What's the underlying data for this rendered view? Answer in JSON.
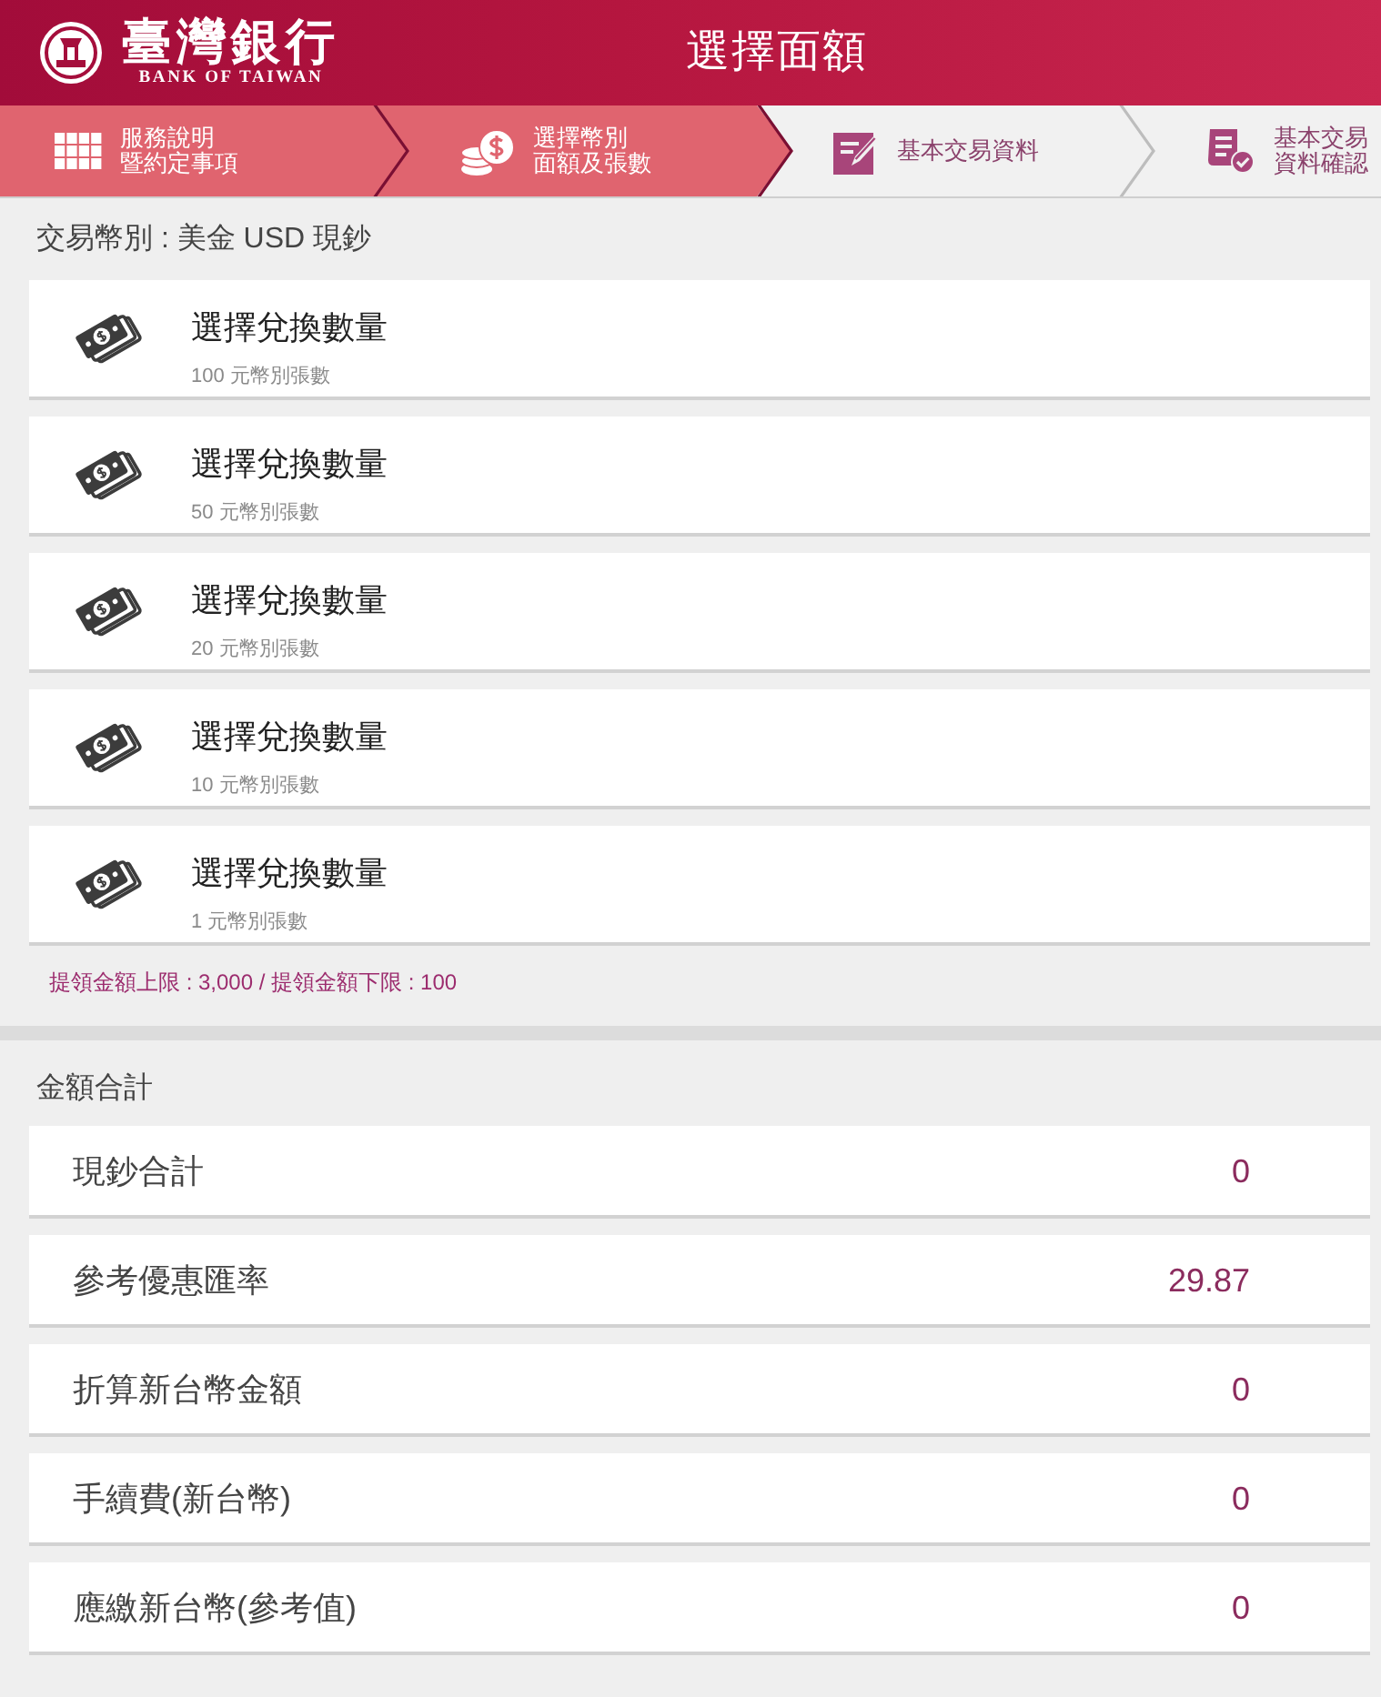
{
  "header": {
    "logo_name": "臺灣銀行",
    "logo_english": "BANK OF TAIWAN",
    "title": "選擇面額"
  },
  "steps": [
    {
      "lines": [
        "服務說明",
        "暨約定事項"
      ],
      "done": true
    },
    {
      "lines": [
        "選擇幣別",
        "面額及張數"
      ],
      "done": true
    },
    {
      "lines": [
        "基本交易資料"
      ],
      "done": false
    },
    {
      "lines": [
        "基本交易",
        "資料確認"
      ],
      "done": false
    }
  ],
  "currency": {
    "label": "交易幣別 : 美金 USD 現鈔"
  },
  "denominations": [
    {
      "title": "選擇兌換數量",
      "caption": "100 元幣別張數"
    },
    {
      "title": "選擇兌換數量",
      "caption": "50 元幣別張數"
    },
    {
      "title": "選擇兌換數量",
      "caption": "20 元幣別張數"
    },
    {
      "title": "選擇兌換數量",
      "caption": "10 元幣別張數"
    },
    {
      "title": "選擇兌換數量",
      "caption": "1 元幣別張數"
    }
  ],
  "limit_note": "提領金額上限 : 3,000 / 提領金額下限 : 100",
  "totals": {
    "heading": "金額合計",
    "rows": [
      {
        "label": "現鈔合計",
        "value": "0"
      },
      {
        "label": "參考優惠匯率",
        "value": "29.87"
      },
      {
        "label": "折算新台幣金額",
        "value": "0"
      },
      {
        "label": "手續費(新台幣)",
        "value": "0"
      },
      {
        "label": "應繳新台幣(參考值)",
        "value": "0"
      }
    ]
  }
}
